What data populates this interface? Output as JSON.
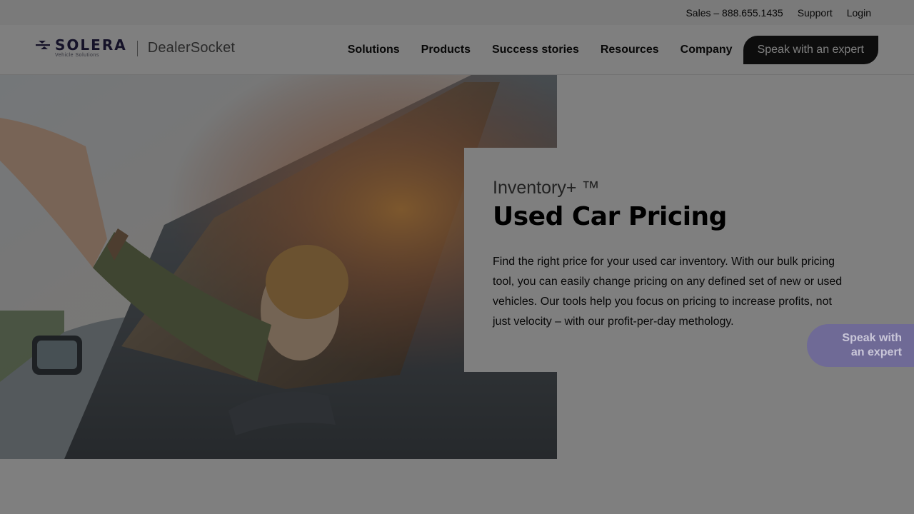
{
  "topbar": {
    "sales": "Sales – 888.655.1435",
    "support": "Support",
    "login": "Login"
  },
  "logo": {
    "solera": "SOLERA",
    "solera_sub": "Vehicle Solutions",
    "dealersocket": "DealerSocket"
  },
  "nav": {
    "items": [
      {
        "label": "Solutions"
      },
      {
        "label": "Products"
      },
      {
        "label": "Success stories"
      },
      {
        "label": "Resources"
      },
      {
        "label": "Company"
      }
    ],
    "cta": "Speak with an expert"
  },
  "hero": {
    "eyebrow": "Inventory+ ™",
    "title": "Used Car Pricing",
    "body": "Find the right price for your used car inventory. With our bulk pricing tool, you can easily change pricing on any defined set of new or used vehicles. Our tools help you focus on pricing to increase profits, not just velocity – with our profit-per-day methology."
  },
  "floating_cta": {
    "line1": "Speak with",
    "line2": "an expert"
  },
  "colors": {
    "brand_purple": "#2a2550",
    "cta_dark": "#1a1a1a",
    "float_purple": "#6f6a96",
    "modal_overlay": "rgba(0,0,0,0.5)"
  },
  "icons": [
    "solera-logo-icon"
  ]
}
